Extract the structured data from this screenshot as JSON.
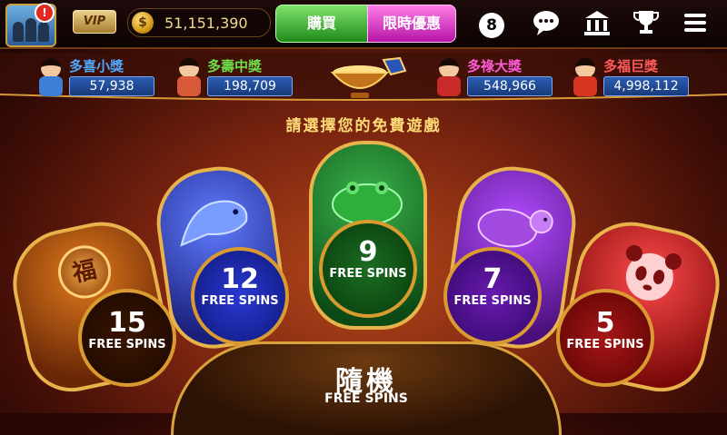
{
  "topbar": {
    "alert_badge": "!",
    "vip_label": "VIP",
    "coin_symbol": "$",
    "coins": "51,151,390",
    "buy_label": "購買",
    "promo_label": "限時優惠",
    "ball8_label": "8",
    "icons": [
      "chat-icon",
      "bank-icon",
      "trophy-icon",
      "menu-icon"
    ]
  },
  "jackpots": [
    {
      "name": "多喜小獎",
      "value": "57,938",
      "color": "#4fa8ff"
    },
    {
      "name": "多壽中獎",
      "value": "198,709",
      "color": "#6fdc4a"
    },
    {
      "name": "多祿大獎",
      "value": "548,966",
      "color": "#ff5ad8"
    },
    {
      "name": "多福巨獎",
      "value": "4,998,112",
      "color": "#ff5a5a"
    }
  ],
  "subtitle": "請選擇您的免費遊戲",
  "options": [
    {
      "id": "coin",
      "number": "15",
      "label": "FREE SPINS",
      "accent": "#b86a16",
      "emblem": "福"
    },
    {
      "id": "koi",
      "number": "12",
      "label": "FREE SPINS",
      "accent": "#2b43c9"
    },
    {
      "id": "toad",
      "number": "9",
      "label": "FREE SPINS",
      "accent": "#1f8a2a"
    },
    {
      "id": "turtle",
      "number": "7",
      "label": "FREE SPINS",
      "accent": "#8b2ad0"
    },
    {
      "id": "panda",
      "number": "5",
      "label": "FREE SPINS",
      "accent": "#c8231f"
    }
  ],
  "random": {
    "title": "隨機",
    "label": "FREE SPINS"
  }
}
